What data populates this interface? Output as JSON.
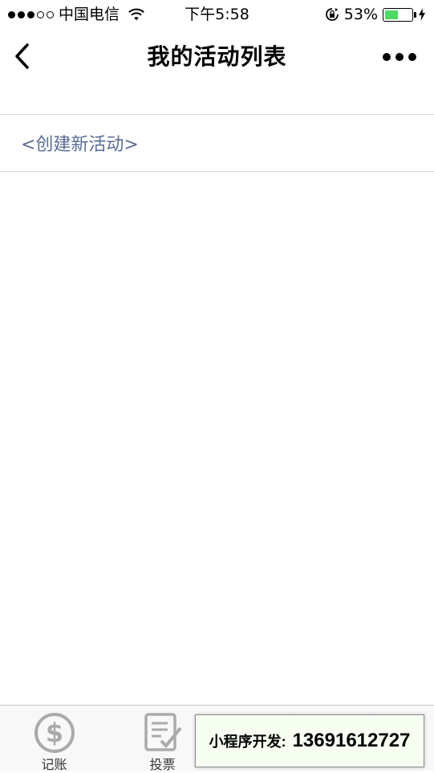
{
  "status_bar": {
    "carrier": "中国电信",
    "time": "下午5:58",
    "battery_percent": "53%",
    "battery_level": 0.53
  },
  "nav": {
    "title": "我的活动列表"
  },
  "content": {
    "create_link": "<创建新活动>"
  },
  "tabs": [
    {
      "label": "记账",
      "icon": "dollar-icon"
    },
    {
      "label": "投票",
      "icon": "checklist-icon"
    },
    {
      "label": "",
      "icon": "tab-3-icon"
    },
    {
      "label": "",
      "icon": "tab-4-icon"
    }
  ],
  "ad": {
    "label": "小程序开发:",
    "phone": "13691612727"
  },
  "colors": {
    "link": "#5a6d94",
    "battery": "#4cd964",
    "tab_active": "#3aa8d8",
    "ad_bg": "#f7fff2"
  }
}
